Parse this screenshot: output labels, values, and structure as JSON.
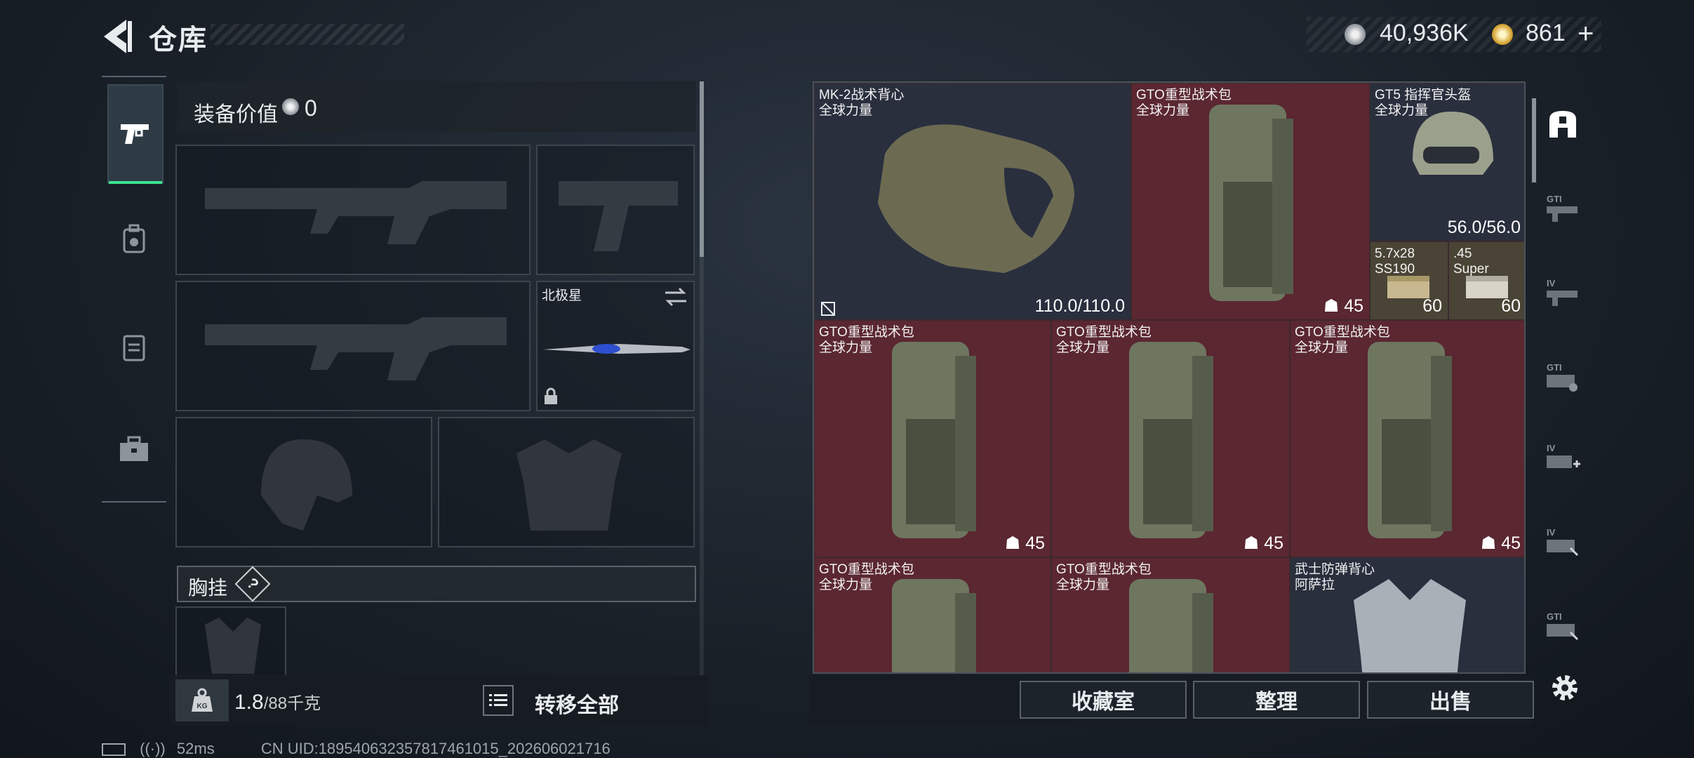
{
  "header": {
    "title": "仓库",
    "currency_silver": "40,936K",
    "currency_gold": "861",
    "add_symbol": "+"
  },
  "left_nav": [
    "pistol-icon",
    "backpack-tab-icon",
    "vest-tab-icon",
    "toolbox-icon"
  ],
  "equipment": {
    "value_label": "装备价值",
    "value": "0",
    "melee_name": "北极星",
    "chest_label": "胸挂",
    "help": "?"
  },
  "footer_left": {
    "kg_icon": "KG",
    "weight_current": "1.8",
    "weight_max": "/88千克",
    "transfer_all": "转移全部"
  },
  "inventory": [
    {
      "name": "MK-2战术背心",
      "sub": "全球力量",
      "value": "110.0/110.0",
      "color": "blue"
    },
    {
      "name": "GTO重型战术包",
      "sub": "全球力量",
      "count": "45",
      "color": "red"
    },
    {
      "name": "GT5 指挥官头盔",
      "sub": "全球力量",
      "value": "56.0/56.0",
      "color": "blue"
    },
    {
      "name": "5.7x28",
      "sub": "SS190",
      "count": "60",
      "color": "ammo"
    },
    {
      "name": ".45",
      "sub": "Super",
      "count": "60",
      "color": "ammo"
    },
    {
      "name": "GTO重型战术包",
      "sub": "全球力量",
      "count": "45",
      "color": "red"
    },
    {
      "name": "GTO重型战术包",
      "sub": "全球力量",
      "count": "45",
      "color": "red"
    },
    {
      "name": "GTO重型战术包",
      "sub": "全球力量",
      "count": "45",
      "color": "red"
    },
    {
      "name": "GTO重型战术包",
      "sub": "全球力量",
      "count": "",
      "color": "red"
    },
    {
      "name": "GTO重型战术包",
      "sub": "全球力量",
      "count": "",
      "color": "red"
    },
    {
      "name": "武士防弹背心",
      "sub": "阿萨拉",
      "count": "",
      "color": "blue"
    }
  ],
  "right_icons": [
    "safe-box-icon",
    "gti-weapon-icon-1",
    "iv-weapon-icon-1",
    "gti-weapon-icon-2",
    "iv-medic-icon",
    "iv-weapon-icon-2",
    "gti-weapon-icon-3"
  ],
  "footer_right": {
    "collection": "收藏室",
    "organize": "整理",
    "sell": "出售"
  },
  "status": {
    "ping": "52ms",
    "uid": "CN UID:18954063235781746101​5_202606021716"
  }
}
